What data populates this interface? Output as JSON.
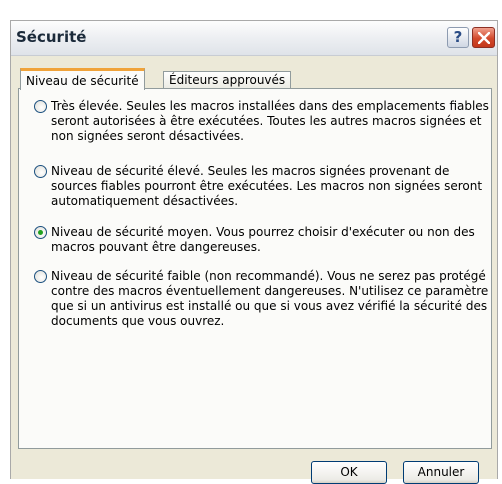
{
  "window": {
    "title": "Sécurité",
    "help_glyph": "?",
    "close_icon": "close-icon"
  },
  "tabs": [
    {
      "label": "Niveau de sécurité",
      "selected": true
    },
    {
      "label": "Éditeurs approuvés",
      "selected": false
    }
  ],
  "options": [
    {
      "label": "Très élevée. Seules les macros installées dans des emplacements fiables seront autorisées à être exécutées. Toutes les autres macros signées et non signées seront désactivées.",
      "checked": false
    },
    {
      "label": "Niveau de sécurité élevé. Seules les macros signées provenant de sources fiables pourront être exécutées. Les macros non signées seront automatiquement désactivées.",
      "checked": false
    },
    {
      "label": "Niveau de sécurité moyen. Vous pourrez choisir d'exécuter ou non des macros pouvant être dangereuses.",
      "checked": true
    },
    {
      "label": "Niveau de sécurité faible (non recommandé). Vous ne serez pas protégé contre des macros éventuellement dangereuses. N'utilisez ce paramètre que si un antivirus est installé ou que si vous avez vérifié la sécurité des documents que vous ouvrez.",
      "checked": false
    }
  ],
  "buttons": {
    "ok": "OK",
    "cancel": "Annuler"
  },
  "colors": {
    "dialog_bg": "#ece9d8",
    "tab_accent": "#f0a33a",
    "radio_dot": "#21a121",
    "close_button": "#d2492b"
  }
}
